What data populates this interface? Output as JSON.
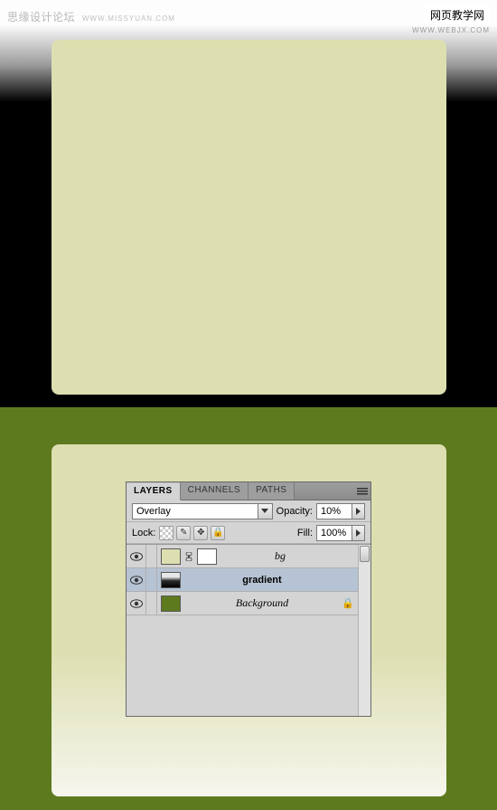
{
  "watermarks": {
    "left_main": "思缘设计论坛",
    "left_sub": "WWW.MISSYUAN.COM",
    "right_main": "网页教学网",
    "right_sub": "WWW.WEBJX.COM"
  },
  "panel": {
    "tabs": {
      "layers": "LAYERS",
      "channels": "CHANNELS",
      "paths": "PATHS"
    },
    "blend_mode": "Overlay",
    "opacity_label": "Opacity:",
    "opacity_value": "10%",
    "lock_label": "Lock:",
    "fill_label": "Fill:",
    "fill_value": "100%",
    "layers": [
      {
        "name": "bg",
        "bold": false
      },
      {
        "name": "gradient",
        "bold": true
      },
      {
        "name": "Background",
        "bold": false
      }
    ],
    "lock_glyph": "🔒",
    "brush_glyph": "✎",
    "move_glyph": "✥",
    "link_glyph": "⋮"
  }
}
